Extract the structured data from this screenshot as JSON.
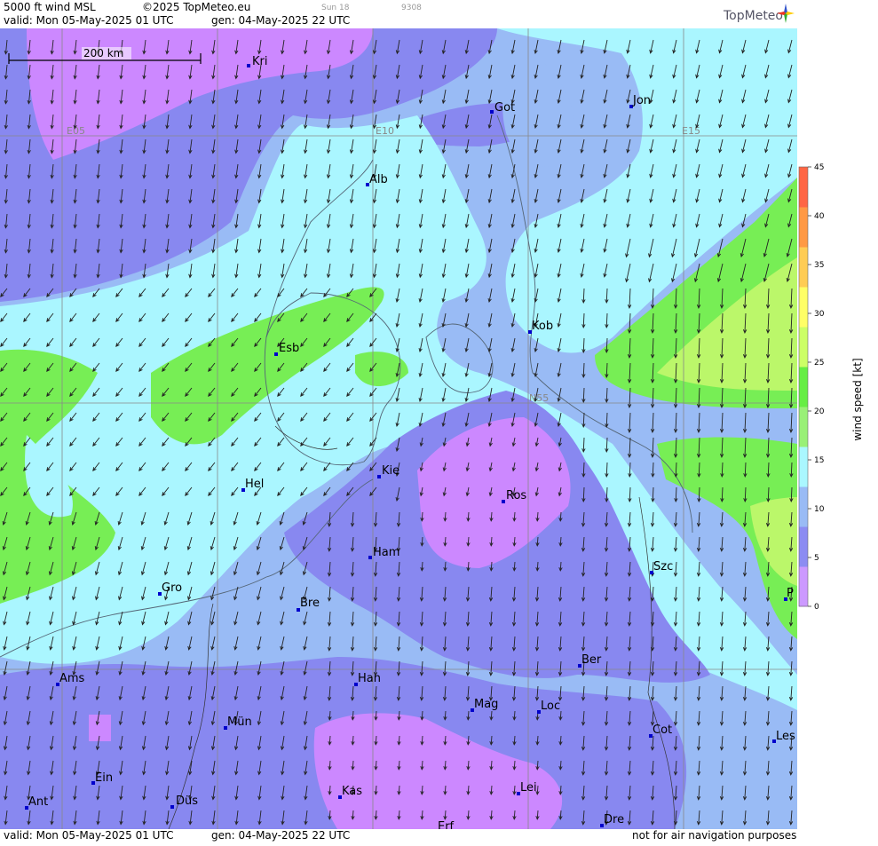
{
  "header": {
    "title": "5000 ft wind MSL",
    "copyright": "©2025 TopMeteo.eu",
    "valid": "valid:  Mon  05-May-2025  01 UTC",
    "generated": "gen: 04-May-2025 22 UTC",
    "sun": "Sun 18",
    "code": "9308",
    "logo": "TopMeteo"
  },
  "footer": {
    "valid": "valid:  Mon  05-May-2025  01 UTC",
    "generated": "gen: 04-May-2025 22 UTC",
    "disclaimer": "not for air navigation purposes"
  },
  "map": {
    "scale_bar": "200 km",
    "grid_labels": [
      "E05",
      "E10",
      "E15",
      "N55"
    ],
    "cities": [
      {
        "name": "Kri"
      },
      {
        "name": "Got"
      },
      {
        "name": "Jon"
      },
      {
        "name": "Alb"
      },
      {
        "name": "Kob"
      },
      {
        "name": "Esb"
      },
      {
        "name": "Kie"
      },
      {
        "name": "Hel"
      },
      {
        "name": "Ros"
      },
      {
        "name": "Ham"
      },
      {
        "name": "Szc"
      },
      {
        "name": "Gro"
      },
      {
        "name": "Bre"
      },
      {
        "name": "P"
      },
      {
        "name": "Ber"
      },
      {
        "name": "Ams"
      },
      {
        "name": "Han"
      },
      {
        "name": "Mag"
      },
      {
        "name": "Loc"
      },
      {
        "name": "Mün"
      },
      {
        "name": "Cot"
      },
      {
        "name": "Les"
      },
      {
        "name": "Ein"
      },
      {
        "name": "Kas"
      },
      {
        "name": "Lei"
      },
      {
        "name": "Ant"
      },
      {
        "name": "Düs"
      },
      {
        "name": "Dre"
      },
      {
        "name": "Erf"
      }
    ]
  },
  "legend": {
    "title": "wind speed [kt]",
    "ticks": [
      "45",
      "40",
      "35",
      "30",
      "25",
      "20",
      "15",
      "10",
      "5",
      "0"
    ],
    "colors": [
      "#cc99ff",
      "#8c8cf2",
      "#99bbf5",
      "#aaf7ff",
      "#99f077",
      "#66ee44",
      "#ccff66",
      "#ffff66",
      "#ffcc55",
      "#ff9944",
      "#ff6644"
    ]
  },
  "colors": {
    "lt5": "#cc88ff",
    "c5_10": "#8888f0",
    "c10_15": "#99bbf5",
    "c15_20": "#aaf6ff",
    "c20_25": "#77ee55",
    "c25_30": "#bbf76a",
    "city_marker": "#0000cc"
  }
}
